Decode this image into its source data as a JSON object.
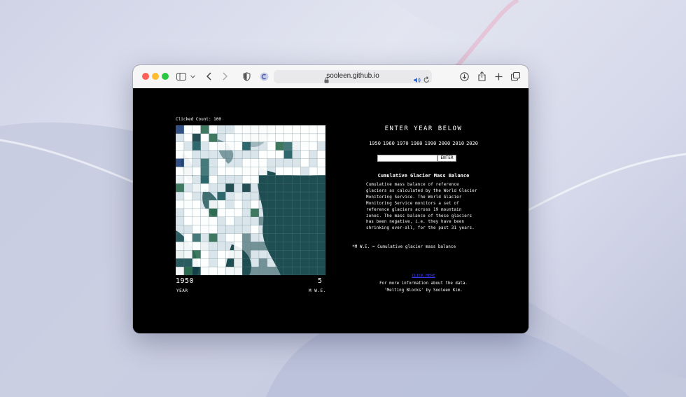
{
  "browser": {
    "url": "sooleen.github.io"
  },
  "page": {
    "clicked_count": "Clicked Count: 100",
    "year_value": "1950",
    "year_label": "YEAR",
    "mwe_value": "5",
    "mwe_label": "M W.E.",
    "heading": "ENTER YEAR BELOW",
    "years": [
      "1950",
      "1960",
      "1970",
      "1980",
      "1990",
      "2000",
      "2010",
      "2020"
    ],
    "year_input_value": "",
    "enter_label": "ENTER",
    "subtitle": "Cumulative Glacier Mass Balance",
    "description": "Cumulative mass balance of reference glaciers as calculated by the World Glacier Monitoring Service. The World Glacier Monitoring Service monitors a set of reference glaciers across 19 mountain zones. The mass balance of these glaciers has been negative, i.e. they have been shrinking over-all, for the past 31 years.",
    "note": "*M W.E. = Cumulative glacier mass balance",
    "link_text": "CLICK HERE",
    "info_line1": "For more information about the data.",
    "info_line2": "'Melting Blocks' by Sooleen Kim."
  },
  "colors": {
    "background": "#000000",
    "link": "#3b3bff",
    "water": "#1f4e52",
    "ice": "#d6e3e8",
    "accent_green": "#2c6b50",
    "accent_blue": "#1f3f78"
  }
}
